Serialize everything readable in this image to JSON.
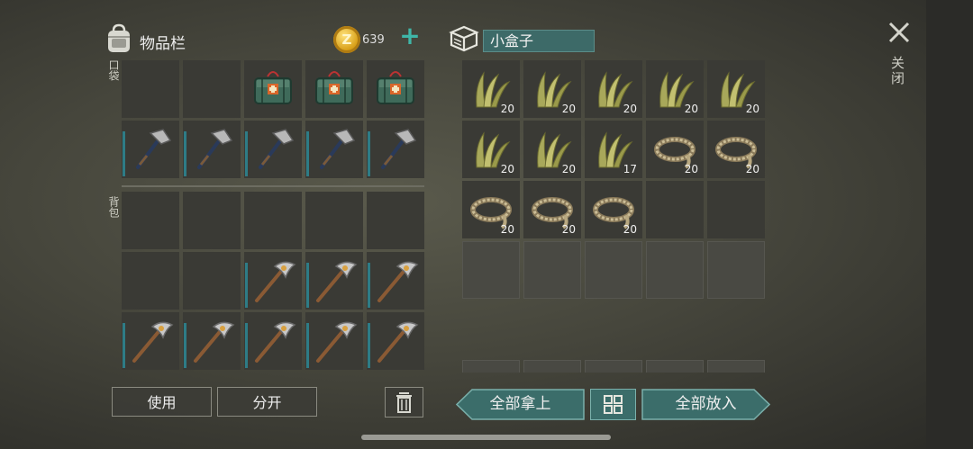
{
  "inventory": {
    "title": "物品栏",
    "coins": "639",
    "pocket_label": "口袋",
    "backpack_label": "背包",
    "pocket": [
      {
        "item": "empty"
      },
      {
        "item": "empty"
      },
      {
        "item": "medkit"
      },
      {
        "item": "medkit"
      },
      {
        "item": "medkit"
      },
      {
        "item": "hatchet",
        "durability": true
      },
      {
        "item": "hatchet",
        "durability": true
      },
      {
        "item": "hatchet",
        "durability": true
      },
      {
        "item": "hatchet",
        "durability": true
      },
      {
        "item": "hatchet",
        "durability": true
      }
    ],
    "backpack": [
      {
        "item": "empty"
      },
      {
        "item": "empty"
      },
      {
        "item": "empty"
      },
      {
        "item": "empty"
      },
      {
        "item": "empty"
      },
      {
        "item": "empty"
      },
      {
        "item": "empty"
      },
      {
        "item": "pickaxe",
        "durability": true
      },
      {
        "item": "pickaxe",
        "durability": true
      },
      {
        "item": "pickaxe",
        "durability": true
      },
      {
        "item": "pickaxe",
        "durability": true
      },
      {
        "item": "pickaxe",
        "durability": true
      },
      {
        "item": "pickaxe",
        "durability": true
      },
      {
        "item": "pickaxe",
        "durability": true
      },
      {
        "item": "pickaxe",
        "durability": true
      }
    ],
    "use_label": "使用",
    "split_label": "分开"
  },
  "container": {
    "name": "小盒子",
    "slots": [
      {
        "item": "grass",
        "qty": "20"
      },
      {
        "item": "grass",
        "qty": "20"
      },
      {
        "item": "grass",
        "qty": "20"
      },
      {
        "item": "grass",
        "qty": "20"
      },
      {
        "item": "grass",
        "qty": "20"
      },
      {
        "item": "grass",
        "qty": "20"
      },
      {
        "item": "grass",
        "qty": "20"
      },
      {
        "item": "grass",
        "qty": "17"
      },
      {
        "item": "rope",
        "qty": "20"
      },
      {
        "item": "rope",
        "qty": "20"
      },
      {
        "item": "rope",
        "qty": "20"
      },
      {
        "item": "rope",
        "qty": "20"
      },
      {
        "item": "rope",
        "qty": "20"
      },
      {
        "item": "empty"
      },
      {
        "item": "empty"
      },
      {
        "item": "locked"
      },
      {
        "item": "locked"
      },
      {
        "item": "locked"
      },
      {
        "item": "locked"
      },
      {
        "item": "locked"
      },
      {
        "item": "locked"
      },
      {
        "item": "locked"
      },
      {
        "item": "locked"
      },
      {
        "item": "locked"
      },
      {
        "item": "locked"
      }
    ],
    "take_all_label": "全部拿上",
    "put_all_label": "全部放入"
  },
  "close_label": "关闭",
  "icons": {
    "bag": "backpack-icon",
    "coin": "coin-icon",
    "plus": "plus-icon",
    "box": "box-icon",
    "close": "close-icon",
    "trash": "trash-icon",
    "sort": "sort-grid-icon",
    "medkit": "medkit-icon",
    "hatchet": "hatchet-icon",
    "pickaxe": "pickaxe-icon",
    "grass": "grass-icon",
    "rope": "rope-icon"
  },
  "colors": {
    "accent": "#3d6a68",
    "durability": "#2e7c86",
    "coin": "#d9a11a"
  }
}
